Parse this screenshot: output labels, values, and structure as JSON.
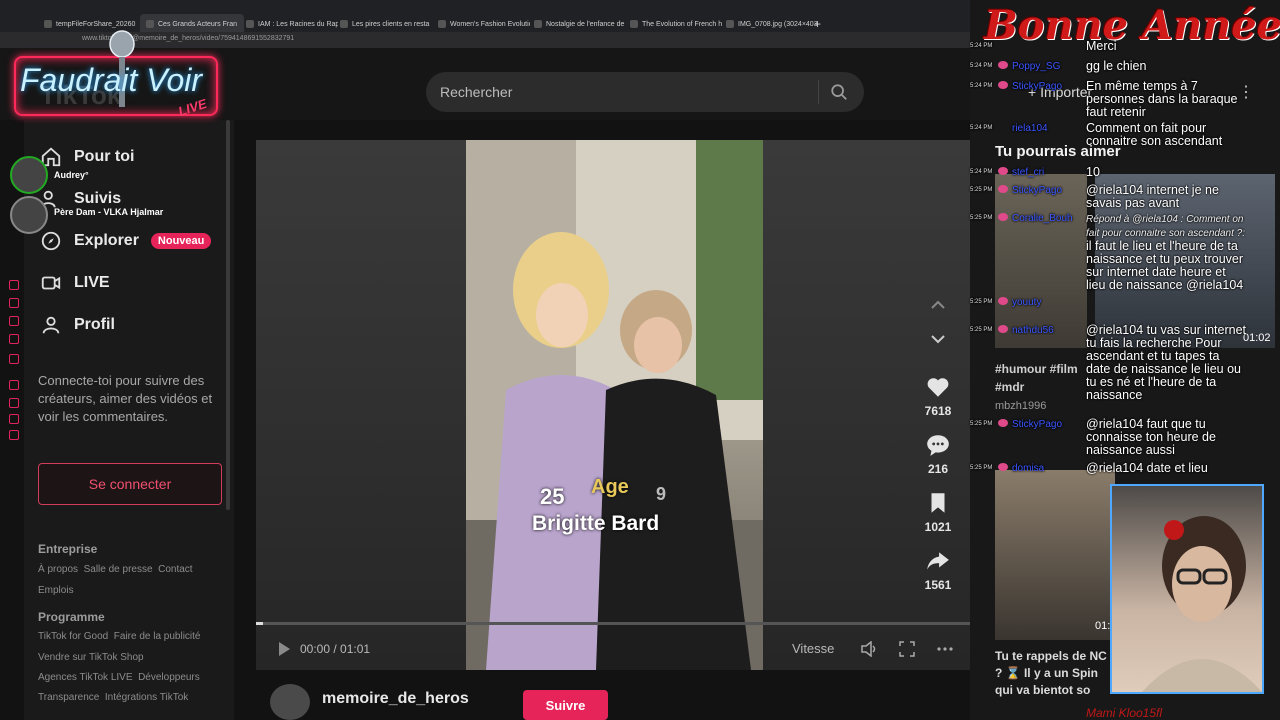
{
  "browser": {
    "tabs": [
      {
        "label": "tempFileForShare_20260"
      },
      {
        "label": "Ces Grands Acteurs Fran"
      },
      {
        "label": "IAM : Les Racines du Rap"
      },
      {
        "label": "Les pires clients en resta"
      },
      {
        "label": "Women's Fashion Evolutio"
      },
      {
        "label": "Nostalgie de l'enfance de"
      },
      {
        "label": "The Evolution of French h"
      },
      {
        "label": "IMG_0708.jpg (3024×403"
      }
    ],
    "new_tab": "+",
    "url": "www.tiktok.com/@memoire_de_heros/video/7594148691552832791"
  },
  "tiktok": {
    "logo": "TikTok",
    "search_placeholder": "Rechercher",
    "nav": [
      {
        "label": "Pour toi",
        "icon": "home-icon"
      },
      {
        "label": "Suivis",
        "icon": "users-icon"
      },
      {
        "label": "Explorer",
        "icon": "compass-icon",
        "badge": "Nouveau"
      },
      {
        "label": "LIVE",
        "icon": "live-icon"
      },
      {
        "label": "Profil",
        "icon": "profile-icon"
      }
    ],
    "login_note": "Connecte-toi pour suivre des créateurs, aimer des vidéos et voir les commentaires.",
    "login_button": "Se connecter",
    "footer": {
      "h1": "Entreprise",
      "links1": [
        "À propos",
        "Salle de presse",
        "Contact"
      ],
      "links1b": [
        "Emplois"
      ],
      "h2": "Programme",
      "links2": [
        "TikTok for Good",
        "Faire de la publicité"
      ],
      "links2b": [
        "Vendre sur TikTok Shop"
      ],
      "links2c": [
        "Agences TikTok LIVE",
        "Développeurs"
      ],
      "links2d": [
        "Transparence",
        "Intégrations TikTok"
      ]
    },
    "video": {
      "overlay_age_label": "Age",
      "overlay_age_young": "25",
      "overlay_age_old": "9",
      "overlay_name": "Brigitte Bard",
      "time": "00:00 / 01:01",
      "speed": "Vitesse",
      "progress_fraction": 0.01
    },
    "actions": {
      "likes": "7618",
      "comments": "216",
      "saves": "1021",
      "shares": "1561"
    },
    "author": "memoire_de_heros",
    "follow": "Suivre",
    "right_panel": {
      "import": "Importer",
      "title": "Tu pourrais aimer",
      "thumb1_duration": "01:02",
      "tags": "#humour #film #mdr",
      "tags_user": "mbzh1996",
      "thumb3_duration": "01:",
      "thumb4_caption": "Tu te rappels de NC ? ⌛ Il y a un Spin qui va bientot so"
    }
  },
  "chat": [
    {
      "time": "5:24 PM",
      "user": "",
      "msg": "Merci"
    },
    {
      "time": "5:24 PM",
      "user": "Poppy_SG",
      "msg": "gg le chien"
    },
    {
      "time": "5:24 PM",
      "user": "StickyPago",
      "msg": "En même temps à 7 personnes dans la baraque faut retenir"
    },
    {
      "time": "5:24 PM",
      "user": "riela104",
      "msg": "Comment on fait pour connaitre son ascendant"
    },
    {
      "time": "5:24 PM",
      "user": "stef_cri",
      "msg": "10"
    },
    {
      "time": "5:25 PM",
      "user": "StickyPago",
      "msg": "@riela104 internet je ne savais pas avant"
    },
    {
      "time": "5:25 PM",
      "user": "Coralie_Bouh",
      "reply": "Répond à @riela104 : Comment on fait pour connaitre son ascendant ?:",
      "msg": "il faut le lieu et l'heure de ta naissance et tu peux trouver sur internet date heure et lieu de naissance @riela104"
    },
    {
      "time": "5:25 PM",
      "user": "youuty",
      "msg": ""
    },
    {
      "time": "5:25 PM",
      "user": "nathdu56",
      "msg": "@riela104 tu vas sur internet tu fais la recherche Pour ascendant et tu tapes ta date de naissance le lieu ou tu es né et l'heure de ta naissance"
    },
    {
      "time": "5:25 PM",
      "user": "StickyPago",
      "msg": "@riela104 faut que tu connaisse ton heure de naissance aussi"
    },
    {
      "time": "5:25 PM",
      "user": "domisa",
      "msg": "@riela104 date et lieu"
    }
  ],
  "stream": {
    "banner": "Bonne Année",
    "logo": "Faudrait Voir",
    "logo_sub": "LIVE",
    "viewers": [
      {
        "name": "Audrey°"
      },
      {
        "name": "Père Dam - VLKA Hjalmar"
      }
    ],
    "webcam_name": "Mami Kloo15fl"
  },
  "colors": {
    "accent": "#e6245a",
    "link_user": "#3a55ff",
    "banner_red": "#d01a1a"
  }
}
